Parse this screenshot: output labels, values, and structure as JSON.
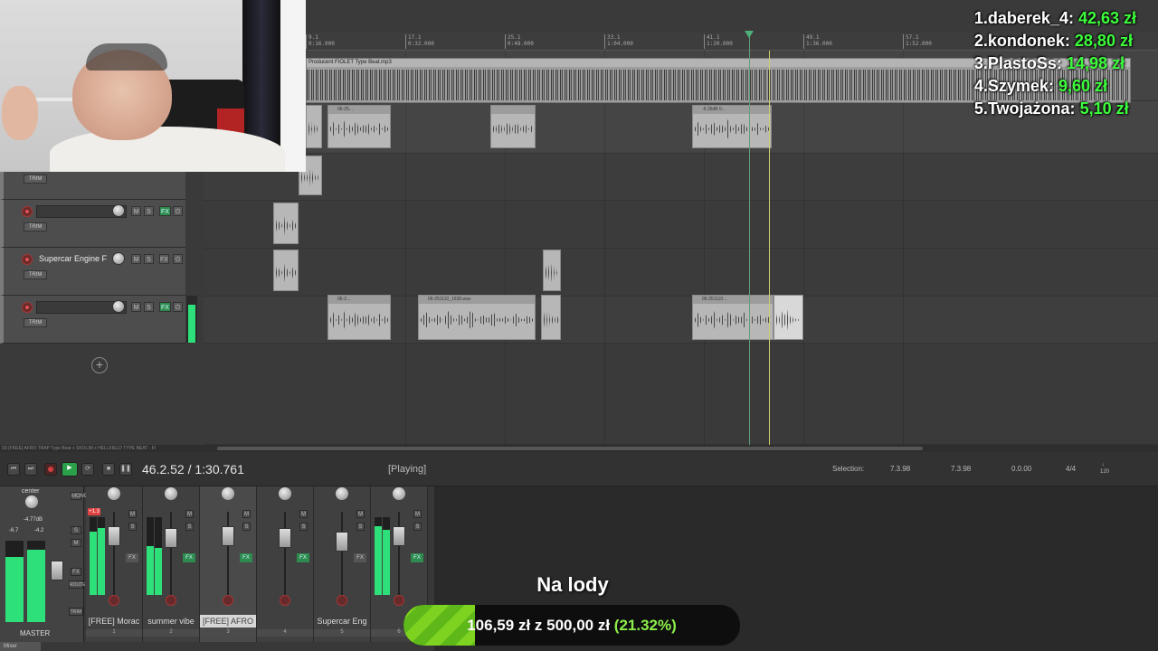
{
  "timeline": {
    "ticks": [
      {
        "bar": "9.1",
        "time": "0:16.000"
      },
      {
        "bar": "17.1",
        "time": "0:32.000"
      },
      {
        "bar": "25.1",
        "time": "0:48.000"
      },
      {
        "bar": "33.1",
        "time": "1:04.000"
      },
      {
        "bar": "41.1",
        "time": "1:20.000"
      },
      {
        "bar": "49.1",
        "time": "1:36.000"
      },
      {
        "bar": "57.1",
        "time": "1:52.000"
      }
    ],
    "first_tick": "9.1"
  },
  "items": {
    "master_item_name": "Producent FIOLET Type Beat.mp3",
    "item_a": "06-25...",
    "item_b": "06-2...",
    "item_c": "06-251110_1639.wav",
    "item_d": "06-251110...",
    "item_e": "-6.35dB 0..."
  },
  "tracks": [
    {
      "name": "",
      "fx_on": true
    },
    {
      "name": "Supercar Engine F",
      "fx_on": false
    },
    {
      "name": "",
      "fx_on": true
    }
  ],
  "track_buttons": {
    "mute": "M",
    "solo": "S",
    "fx": "FX",
    "trim": "TRIM",
    "io": "⏻"
  },
  "donations": [
    {
      "rank": "1.",
      "name": "daberek_4: ",
      "amount": "42,63 zł"
    },
    {
      "rank": "2.",
      "name": "kondonek: ",
      "amount": "28,80 zł"
    },
    {
      "rank": "3.",
      "name": "PlastoSs: ",
      "amount": "14,98 zł"
    },
    {
      "rank": "4.",
      "name": "Szymek: ",
      "amount": "9,60 zł"
    },
    {
      "rank": "5.",
      "name": "Twojażona: ",
      "amount": "5,10 zł"
    }
  ],
  "scrollbar_label": "03-[FREE] AFRO TRAP Type Beat x SKOLIM x HELLFIELD TYPE BEAT - Fl",
  "transport": {
    "time": "46.2.52 / 1:30.761",
    "state": "[Playing]",
    "selection_label": "Selection:",
    "sel_start": "7.3.98",
    "sel_end": "7.3.98",
    "sel_length": "0.0.00",
    "time_signature": "4/4",
    "bpm_label": "♩",
    "bpm": "120"
  },
  "mixer": {
    "master_label": "MASTER",
    "master_pan": "center",
    "master_vol": "-4.77dB",
    "master_peak_l": "-6.7",
    "master_peak_r": "-4.2",
    "master_side": [
      "MONO",
      "S",
      "M",
      "FX",
      "ROUTE",
      "TRIM"
    ],
    "tab": "Mixer",
    "channels": [
      {
        "name": "[FREE] Morac",
        "num": "1",
        "clip": "+1.3",
        "fx_on": false
      },
      {
        "name": "summer vibe",
        "num": "2",
        "clip": "",
        "fx_on": true
      },
      {
        "name": "[FREE] AFRO",
        "num": "3",
        "clip": "",
        "fx_on": true
      },
      {
        "name": "",
        "num": "4",
        "clip": "",
        "fx_on": true
      },
      {
        "name": "Supercar Eng",
        "num": "5",
        "clip": "",
        "fx_on": false
      },
      {
        "name": "",
        "num": "6",
        "clip": "",
        "fx_on": true
      }
    ]
  },
  "goal": {
    "title": "Na lody",
    "current": "106,59 zł",
    "connector": " z ",
    "target": "500,00 zł",
    "percent_text": " (21.32%)",
    "progress": 0.2132
  },
  "colors": {
    "accent_green": "#2ee07a",
    "donation_amount": "#3cff3c",
    "goal_fill": "#7ed321"
  }
}
